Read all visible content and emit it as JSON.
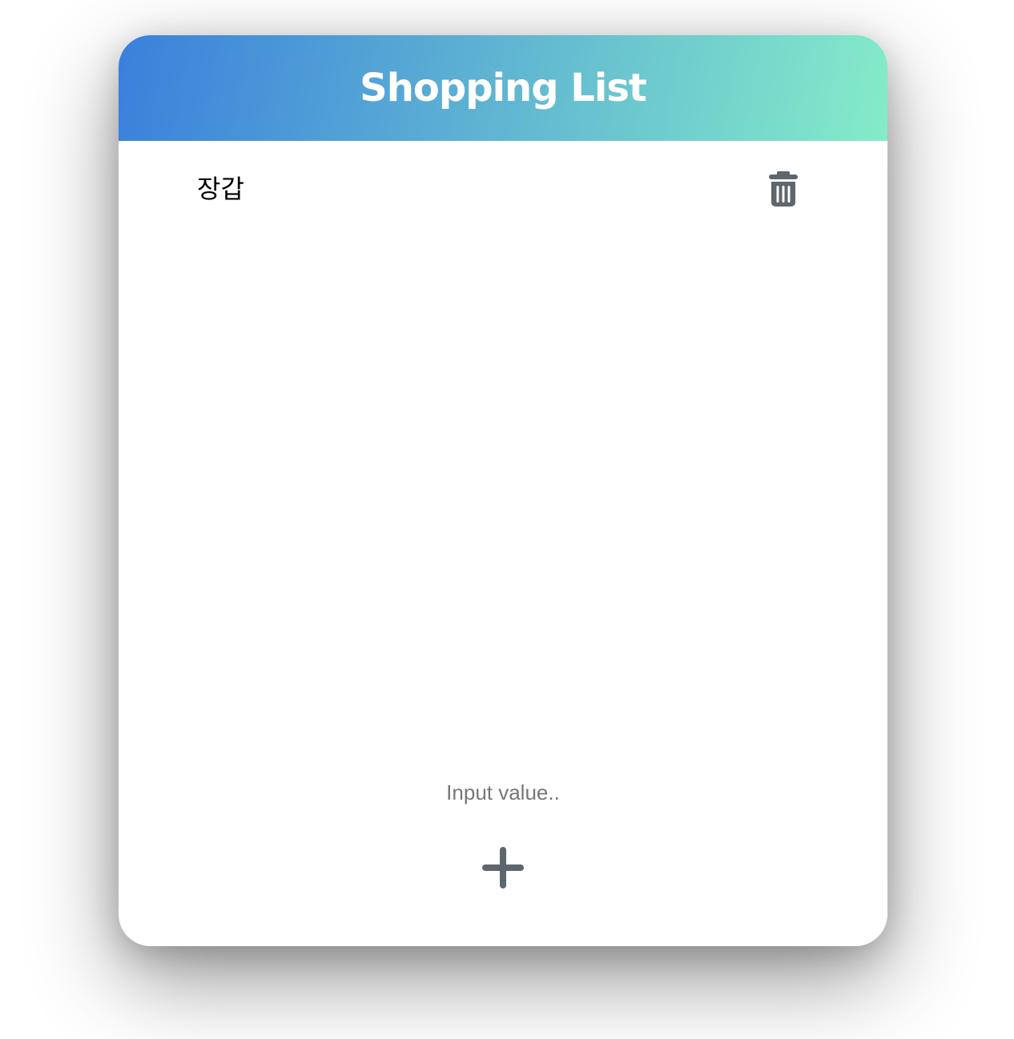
{
  "app": {
    "title": "Shopping List"
  },
  "theme": {
    "gradient_start": "#3b7fdc",
    "gradient_end": "#84ecc8",
    "icon_color": "#5e666d"
  },
  "items": [
    {
      "label": "장갑",
      "delete_icon": "trash-icon"
    }
  ],
  "input": {
    "value": "",
    "placeholder": "Input value.."
  },
  "add_button": {
    "icon": "plus-icon"
  }
}
